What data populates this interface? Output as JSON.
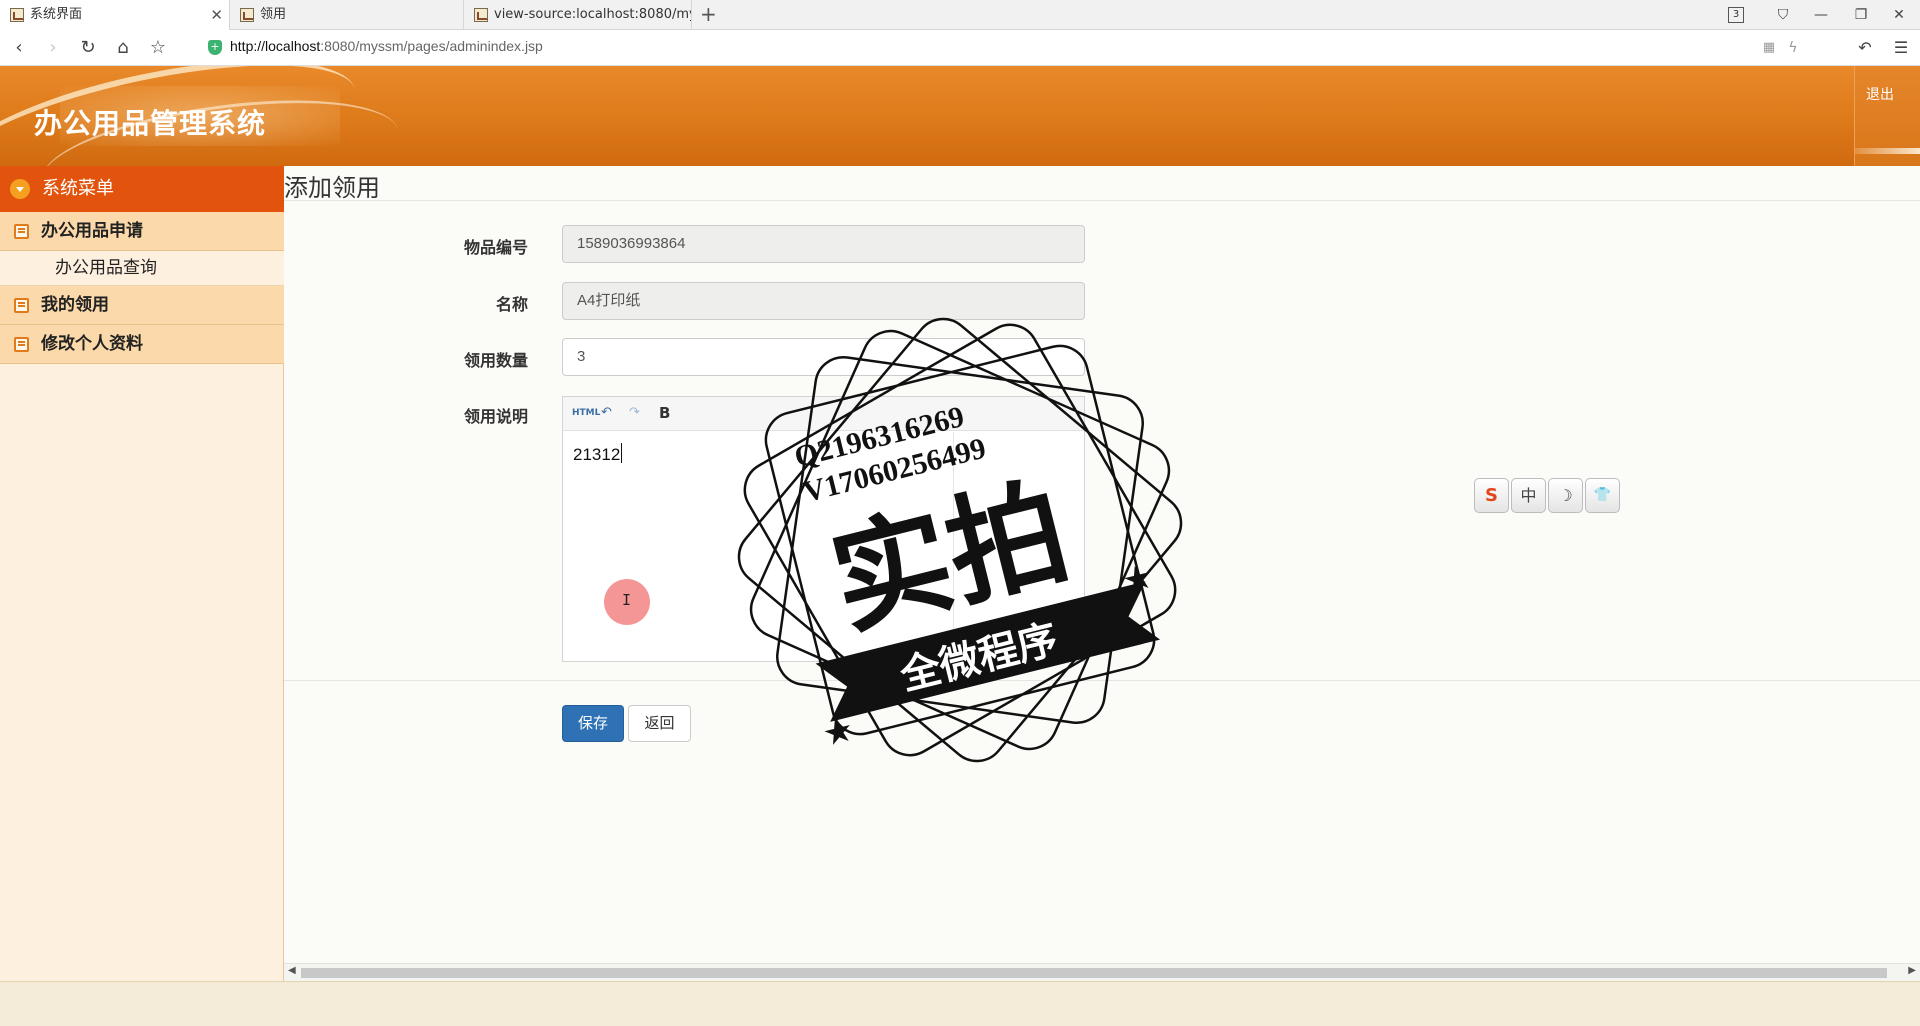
{
  "browser": {
    "tabs": [
      {
        "title": "系统界面"
      },
      {
        "title": "领用"
      },
      {
        "title": "view-source:localhost:8080/my"
      }
    ],
    "tab_count": "3",
    "url_host": "http://localhost",
    "url_rest": ":8080/myssm/pages/adminindex.jsp"
  },
  "header": {
    "title": "办公用品管理系统",
    "logout": "退出",
    "accent_color": "#dd7a1a"
  },
  "sidebar": {
    "menu_title": "系统菜单",
    "groups": [
      {
        "label": "办公用品申请",
        "items": [
          {
            "label": "办公用品查询"
          }
        ]
      },
      {
        "label": "我的领用"
      },
      {
        "label": "修改个人资料"
      }
    ]
  },
  "page": {
    "title": "添加领用",
    "fields": [
      {
        "label": "物品编号",
        "value": "1589036993864",
        "readonly": true
      },
      {
        "label": "名称",
        "value": "A4打印纸",
        "readonly": true
      },
      {
        "label": "领用数量",
        "value": "3"
      },
      {
        "label": "领用说明"
      }
    ],
    "editor": {
      "toolbar_html": "HTML",
      "content": "21312"
    },
    "save_label": "保存",
    "back_label": "返回"
  },
  "ime_toolbar": {
    "sogou": "S",
    "lang": "中",
    "moon": "☽",
    "skin": "👕"
  },
  "watermark": {
    "line1": "Q2196316269",
    "line2": "V17060256499",
    "main": "实拍",
    "banner": "全微程序"
  }
}
